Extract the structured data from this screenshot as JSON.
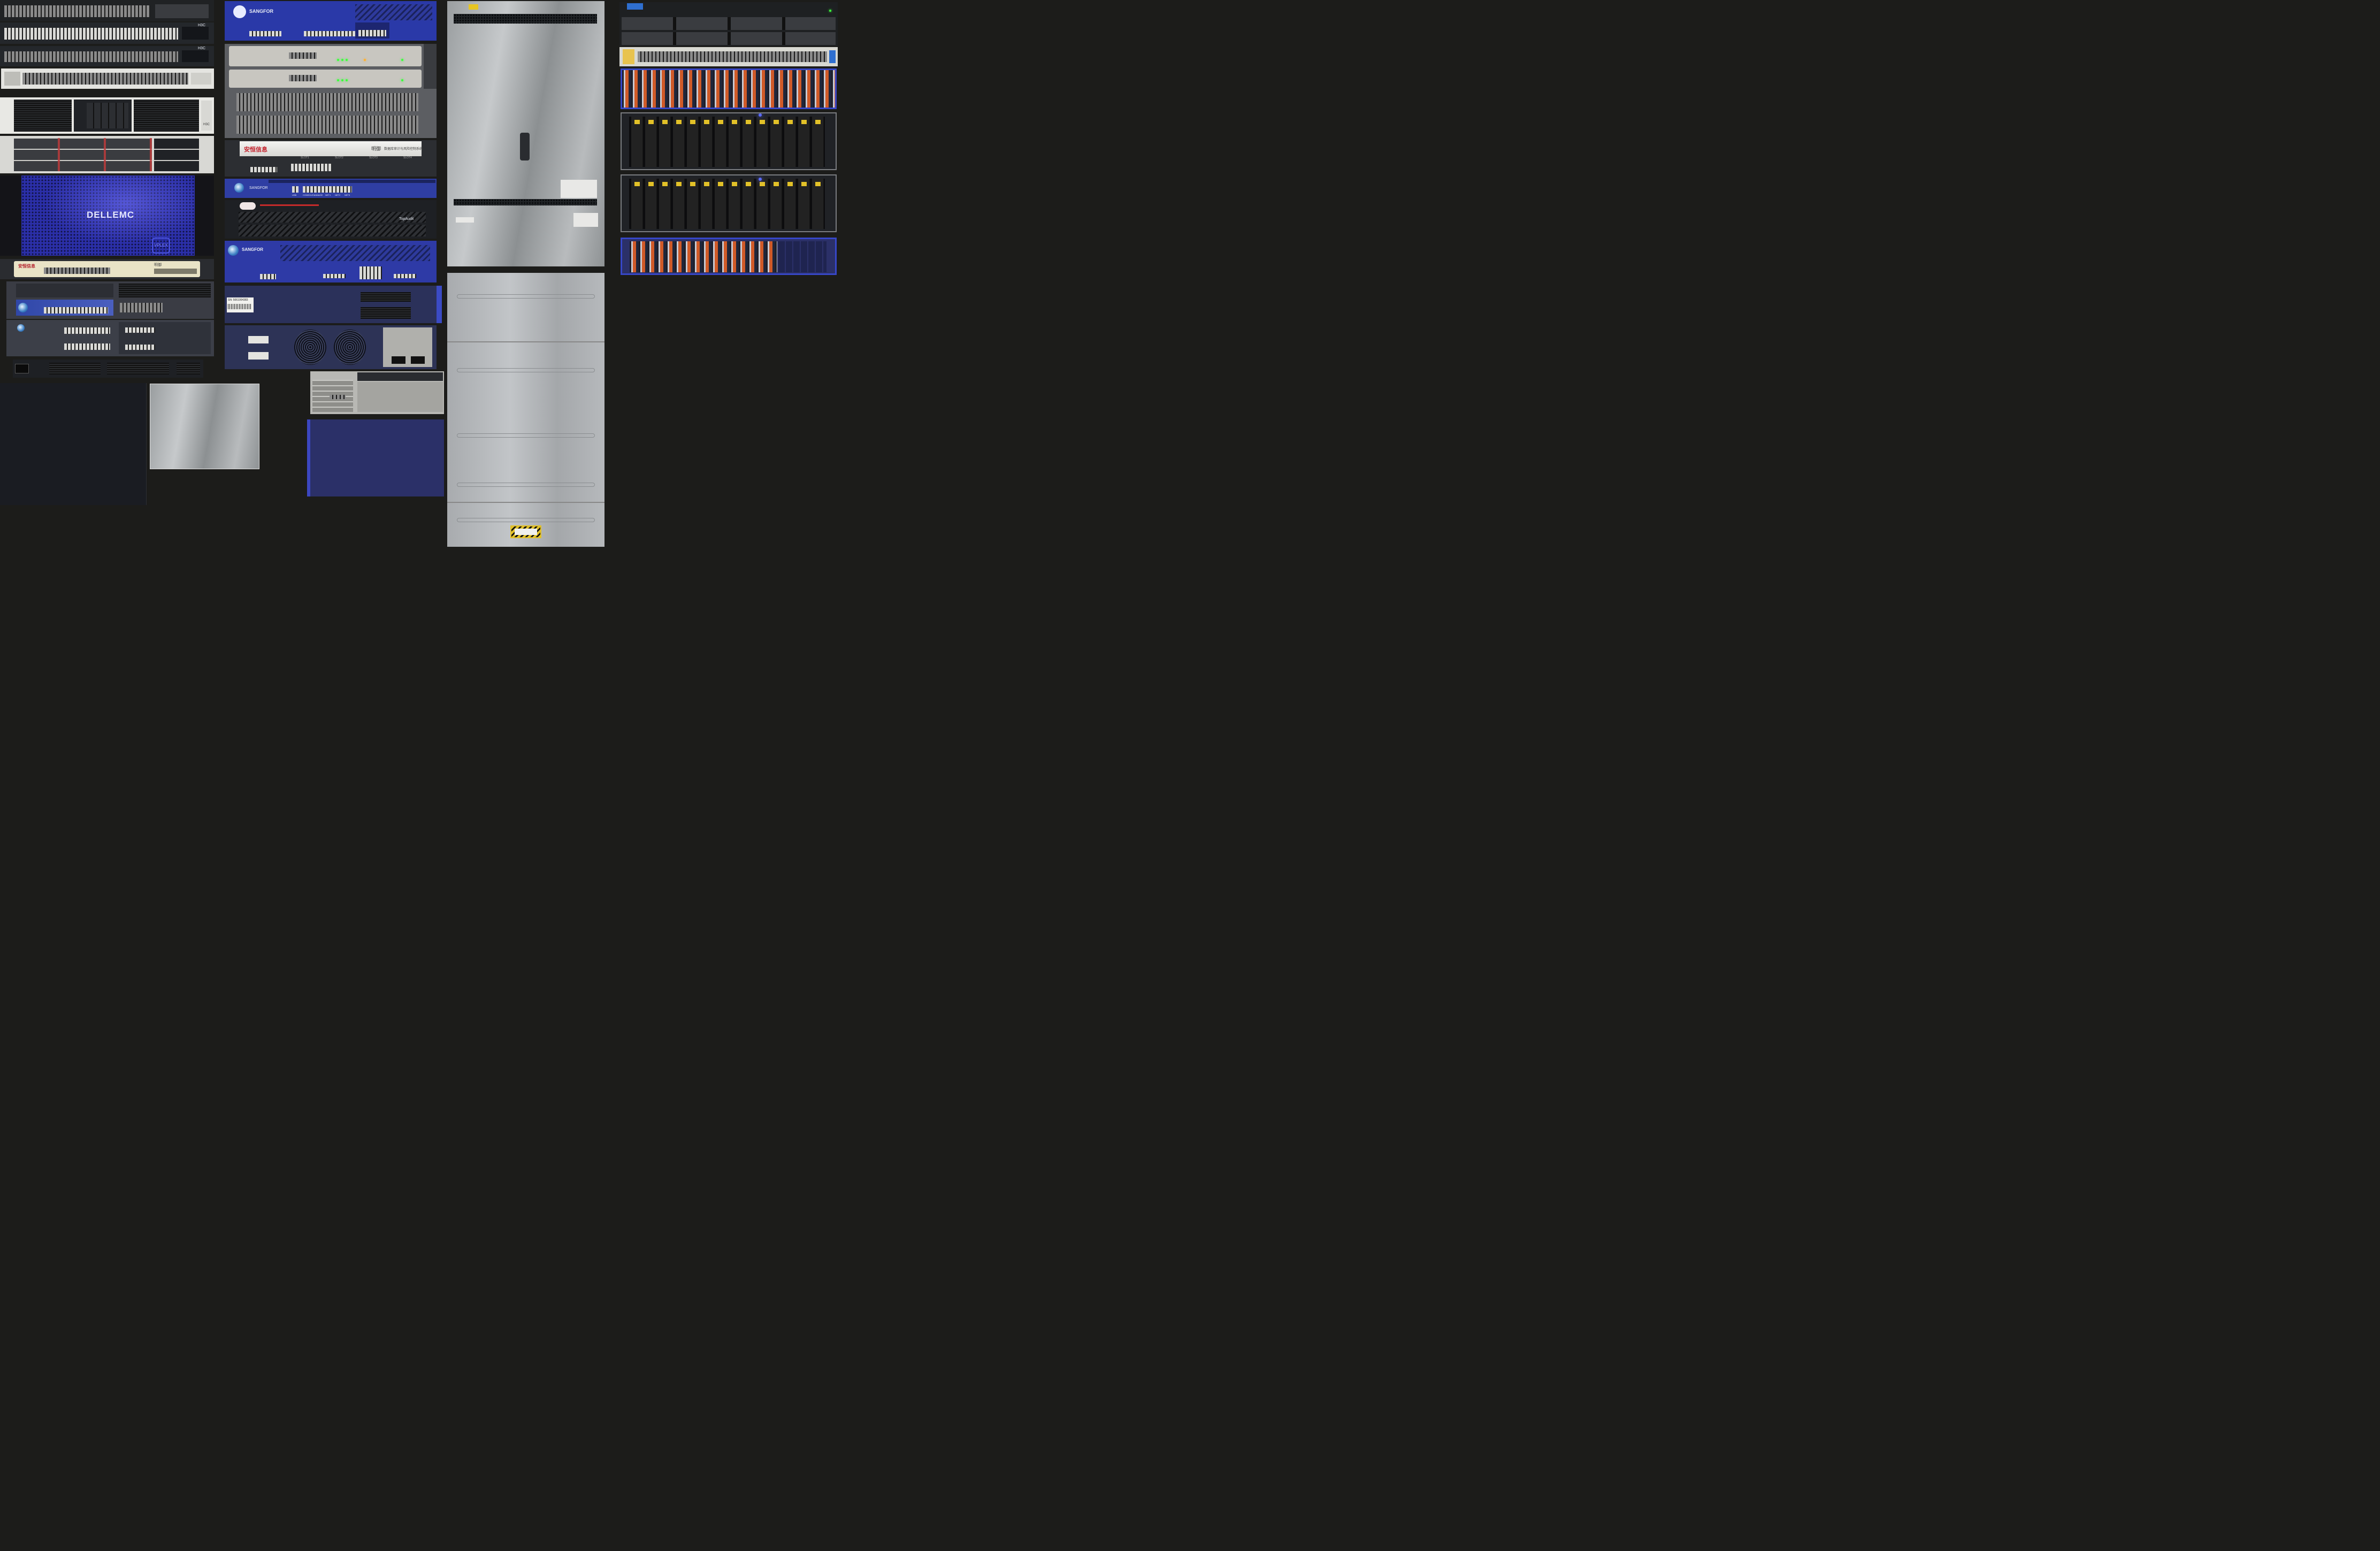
{
  "labels": {
    "h3c_a": "H3C",
    "h3c_b": "H3C",
    "h3c_c": "H3C",
    "sangfor_1": "SANGFOR",
    "sangfor_2": "SANGFOR",
    "sangfor_3": "SANGFOR",
    "dellemc": "DELLEMC",
    "vplex": "VPLEX",
    "anheng_1": "安恒信息",
    "anheng_2": "安恒信息",
    "mingyu": "明御",
    "mingyu_desc": "数据库审计与风险控制系统",
    "topaudit": "TopAudit",
    "serial": "SN: 5061004383",
    "slots": [
      "SLOT1",
      "SLOT2",
      "SLOT3",
      "SLOT4"
    ],
    "sangfor_ports": [
      "USB",
      "CONSOLE",
      "MANAGE",
      "NET1",
      "NET2",
      "NET3"
    ]
  },
  "colors": {
    "background": "#1c1c1a",
    "sangfor_blue": "#2e3a9c",
    "led_green": "#3cff3c",
    "dell_blue": "#2b2fa8",
    "drive_orange": "#d05a28",
    "drive_yellow": "#e2c128"
  }
}
